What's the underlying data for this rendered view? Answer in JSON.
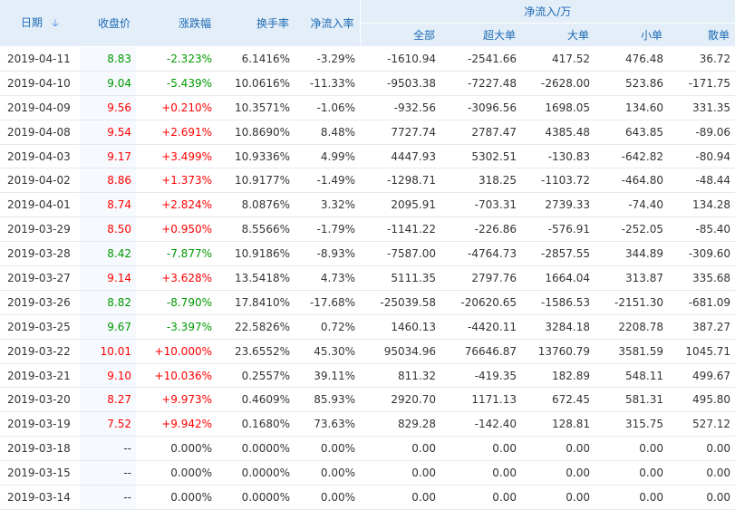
{
  "headers": {
    "date": "日期",
    "sort_icon": "arrow-down-icon",
    "close": "收盘价",
    "change": "涨跌幅",
    "turnover": "换手率",
    "net_inflow_rate": "净流入率",
    "net_inflow_group": "净流入/万",
    "all": "全部",
    "super_large": "超大单",
    "large": "大单",
    "small": "小单",
    "retail": "散单"
  },
  "colors": {
    "up": "#ff0000",
    "down": "#009900",
    "header_bg": "#e3eef9",
    "header_text": "#1f6cb4"
  },
  "rows": [
    {
      "date": "2019-04-11",
      "close": "8.83",
      "change": "-2.323%",
      "turnover": "6.1416%",
      "rate": "-3.29%",
      "all": "-1610.94",
      "super": "-2541.66",
      "large": "417.52",
      "small": "476.48",
      "retail": "36.72",
      "dir": "down"
    },
    {
      "date": "2019-04-10",
      "close": "9.04",
      "change": "-5.439%",
      "turnover": "10.0616%",
      "rate": "-11.33%",
      "all": "-9503.38",
      "super": "-7227.48",
      "large": "-2628.00",
      "small": "523.86",
      "retail": "-171.75",
      "dir": "down"
    },
    {
      "date": "2019-04-09",
      "close": "9.56",
      "change": "+0.210%",
      "turnover": "10.3571%",
      "rate": "-1.06%",
      "all": "-932.56",
      "super": "-3096.56",
      "large": "1698.05",
      "small": "134.60",
      "retail": "331.35",
      "dir": "up"
    },
    {
      "date": "2019-04-08",
      "close": "9.54",
      "change": "+2.691%",
      "turnover": "10.8690%",
      "rate": "8.48%",
      "all": "7727.74",
      "super": "2787.47",
      "large": "4385.48",
      "small": "643.85",
      "retail": "-89.06",
      "dir": "up"
    },
    {
      "date": "2019-04-03",
      "close": "9.17",
      "change": "+3.499%",
      "turnover": "10.9336%",
      "rate": "4.99%",
      "all": "4447.93",
      "super": "5302.51",
      "large": "-130.83",
      "small": "-642.82",
      "retail": "-80.94",
      "dir": "up"
    },
    {
      "date": "2019-04-02",
      "close": "8.86",
      "change": "+1.373%",
      "turnover": "10.9177%",
      "rate": "-1.49%",
      "all": "-1298.71",
      "super": "318.25",
      "large": "-1103.72",
      "small": "-464.80",
      "retail": "-48.44",
      "dir": "up"
    },
    {
      "date": "2019-04-01",
      "close": "8.74",
      "change": "+2.824%",
      "turnover": "8.0876%",
      "rate": "3.32%",
      "all": "2095.91",
      "super": "-703.31",
      "large": "2739.33",
      "small": "-74.40",
      "retail": "134.28",
      "dir": "up"
    },
    {
      "date": "2019-03-29",
      "close": "8.50",
      "change": "+0.950%",
      "turnover": "8.5566%",
      "rate": "-1.79%",
      "all": "-1141.22",
      "super": "-226.86",
      "large": "-576.91",
      "small": "-252.05",
      "retail": "-85.40",
      "dir": "up"
    },
    {
      "date": "2019-03-28",
      "close": "8.42",
      "change": "-7.877%",
      "turnover": "10.9186%",
      "rate": "-8.93%",
      "all": "-7587.00",
      "super": "-4764.73",
      "large": "-2857.55",
      "small": "344.89",
      "retail": "-309.60",
      "dir": "down"
    },
    {
      "date": "2019-03-27",
      "close": "9.14",
      "change": "+3.628%",
      "turnover": "13.5418%",
      "rate": "4.73%",
      "all": "5111.35",
      "super": "2797.76",
      "large": "1664.04",
      "small": "313.87",
      "retail": "335.68",
      "dir": "up"
    },
    {
      "date": "2019-03-26",
      "close": "8.82",
      "change": "-8.790%",
      "turnover": "17.8410%",
      "rate": "-17.68%",
      "all": "-25039.58",
      "super": "-20620.65",
      "large": "-1586.53",
      "small": "-2151.30",
      "retail": "-681.09",
      "dir": "down"
    },
    {
      "date": "2019-03-25",
      "close": "9.67",
      "change": "-3.397%",
      "turnover": "22.5826%",
      "rate": "0.72%",
      "all": "1460.13",
      "super": "-4420.11",
      "large": "3284.18",
      "small": "2208.78",
      "retail": "387.27",
      "dir": "down"
    },
    {
      "date": "2019-03-22",
      "close": "10.01",
      "change": "+10.000%",
      "turnover": "23.6552%",
      "rate": "45.30%",
      "all": "95034.96",
      "super": "76646.87",
      "large": "13760.79",
      "small": "3581.59",
      "retail": "1045.71",
      "dir": "up"
    },
    {
      "date": "2019-03-21",
      "close": "9.10",
      "change": "+10.036%",
      "turnover": "0.2557%",
      "rate": "39.11%",
      "all": "811.32",
      "super": "-419.35",
      "large": "182.89",
      "small": "548.11",
      "retail": "499.67",
      "dir": "up"
    },
    {
      "date": "2019-03-20",
      "close": "8.27",
      "change": "+9.973%",
      "turnover": "0.4609%",
      "rate": "85.93%",
      "all": "2920.70",
      "super": "1171.13",
      "large": "672.45",
      "small": "581.31",
      "retail": "495.80",
      "dir": "up"
    },
    {
      "date": "2019-03-19",
      "close": "7.52",
      "change": "+9.942%",
      "turnover": "0.1680%",
      "rate": "73.63%",
      "all": "829.28",
      "super": "-142.40",
      "large": "128.81",
      "small": "315.75",
      "retail": "527.12",
      "dir": "up"
    },
    {
      "date": "2019-03-18",
      "close": "--",
      "change": "0.000%",
      "turnover": "0.0000%",
      "rate": "0.00%",
      "all": "0.00",
      "super": "0.00",
      "large": "0.00",
      "small": "0.00",
      "retail": "0.00",
      "dir": "flat"
    },
    {
      "date": "2019-03-15",
      "close": "--",
      "change": "0.000%",
      "turnover": "0.0000%",
      "rate": "0.00%",
      "all": "0.00",
      "super": "0.00",
      "large": "0.00",
      "small": "0.00",
      "retail": "0.00",
      "dir": "flat"
    },
    {
      "date": "2019-03-14",
      "close": "--",
      "change": "0.000%",
      "turnover": "0.0000%",
      "rate": "0.00%",
      "all": "0.00",
      "super": "0.00",
      "large": "0.00",
      "small": "0.00",
      "retail": "0.00",
      "dir": "flat"
    }
  ]
}
